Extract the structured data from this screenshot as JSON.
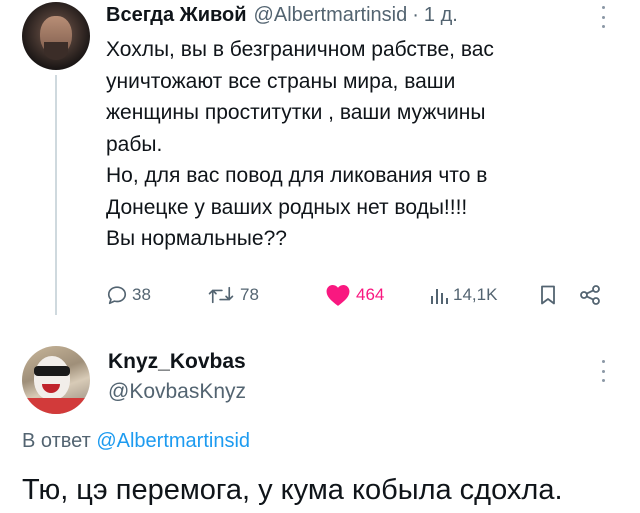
{
  "tweet": {
    "author_name": "Всегда Живой",
    "author_handle": "@Albertmartinsid",
    "separator": "·",
    "timestamp": "1 д.",
    "text": "Хохлы, вы в безграничном рабстве, вас\nуничтожают все страны мира, ваши\nженщины проститутки , ваши мужчины\nрабы.\nНо, для вас повод для ликования что в\nДонецке у ваших родных нет воды!!!!\nВы нормальные??",
    "actions": {
      "replies": "38",
      "retweets": "78",
      "likes": "464",
      "views": "14,1K"
    },
    "icons": {
      "reply": "reply-icon",
      "retweet": "retweet-icon",
      "like": "heart-filled-icon",
      "views": "views-chart-icon",
      "bookmark": "bookmark-icon",
      "share": "share-icon",
      "more": "more-vertical-icon"
    },
    "colors": {
      "like_active": "#f91880",
      "secondary_text": "#536471",
      "thread_line": "#cfd9de"
    }
  },
  "reply": {
    "author_name": "Knyz_Kovbas",
    "author_handle": "@KovbasKnyz",
    "reply_prefix": "В ответ",
    "reply_mention": "@Albertmartinsid",
    "text": "Тю, цэ перемога, у кума кобыла сдохла.",
    "colors": {
      "mention": "#1d9bf0"
    }
  }
}
